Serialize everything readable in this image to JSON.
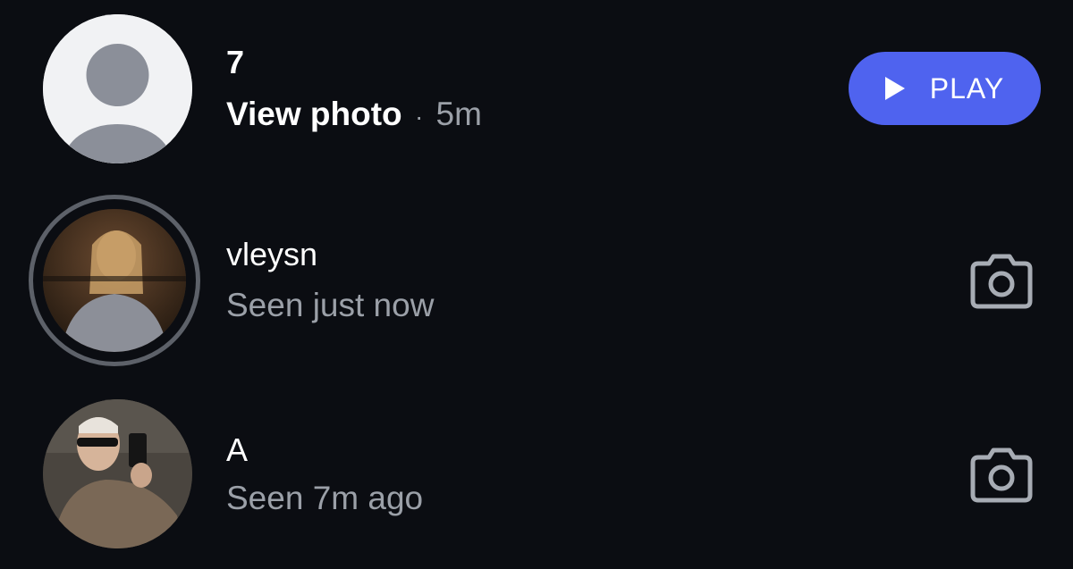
{
  "messages": [
    {
      "name": "7",
      "action": "View photo",
      "separator": "·",
      "time": "5m",
      "button_label": "PLAY",
      "avatar_icon": "default-person-icon",
      "button_icon": "play-icon",
      "button_color": "#4f63ef"
    },
    {
      "name": "vleysn",
      "status": "Seen just now",
      "right_icon": "camera-icon",
      "avatar_ring": true
    },
    {
      "name": "A",
      "status": "Seen 7m ago",
      "right_icon": "camera-icon"
    }
  ],
  "colors": {
    "background": "#0b0d12",
    "secondary_text": "#9ba0a8",
    "accent": "#4f63ef",
    "icon_gray": "#a7acb4"
  }
}
